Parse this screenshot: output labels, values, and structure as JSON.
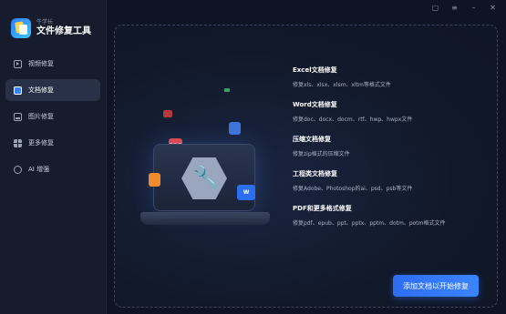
{
  "brand": {
    "subtitle": "牛学长",
    "title": "文件修复工具"
  },
  "nav": [
    {
      "label": "视频修复",
      "icon": "video-icon"
    },
    {
      "label": "文档修复",
      "icon": "document-icon",
      "active": true
    },
    {
      "label": "图片修复",
      "icon": "image-icon"
    },
    {
      "label": "更多修复",
      "icon": "grid-icon"
    },
    {
      "label": "AI 增强",
      "icon": "ai-enhance-icon"
    }
  ],
  "window_controls": [
    "feedback-icon",
    "menu-icon",
    "minimize-icon",
    "close-icon"
  ],
  "illustration": {
    "tiles": {
      "pdf": "PDF",
      "word": "W"
    }
  },
  "formats": [
    {
      "title": "Excel文档修复",
      "desc": "修复xls、xlsx、xlsm、xltm等格式文件"
    },
    {
      "title": "Word文档修复",
      "desc": "修复doc、docx、docm、rtf、hwp、hwpx文件"
    },
    {
      "title": "压缩文档修复",
      "desc": "修复zip格式的压缩文件"
    },
    {
      "title": "工程类文档修复",
      "desc": "修复Adobe、Photoshop的ai、psd、psb等文件"
    },
    {
      "title": "PDF和更多格式修复",
      "desc": "修复pdf、epub、ppt、pptx、pptm、dotm、potm格式文件"
    }
  ],
  "cta": {
    "label": "添加文档以开始修复"
  },
  "colors": {
    "accent": "#2e6df2",
    "background": "#0e1424",
    "sidebar": "#161c2c"
  }
}
